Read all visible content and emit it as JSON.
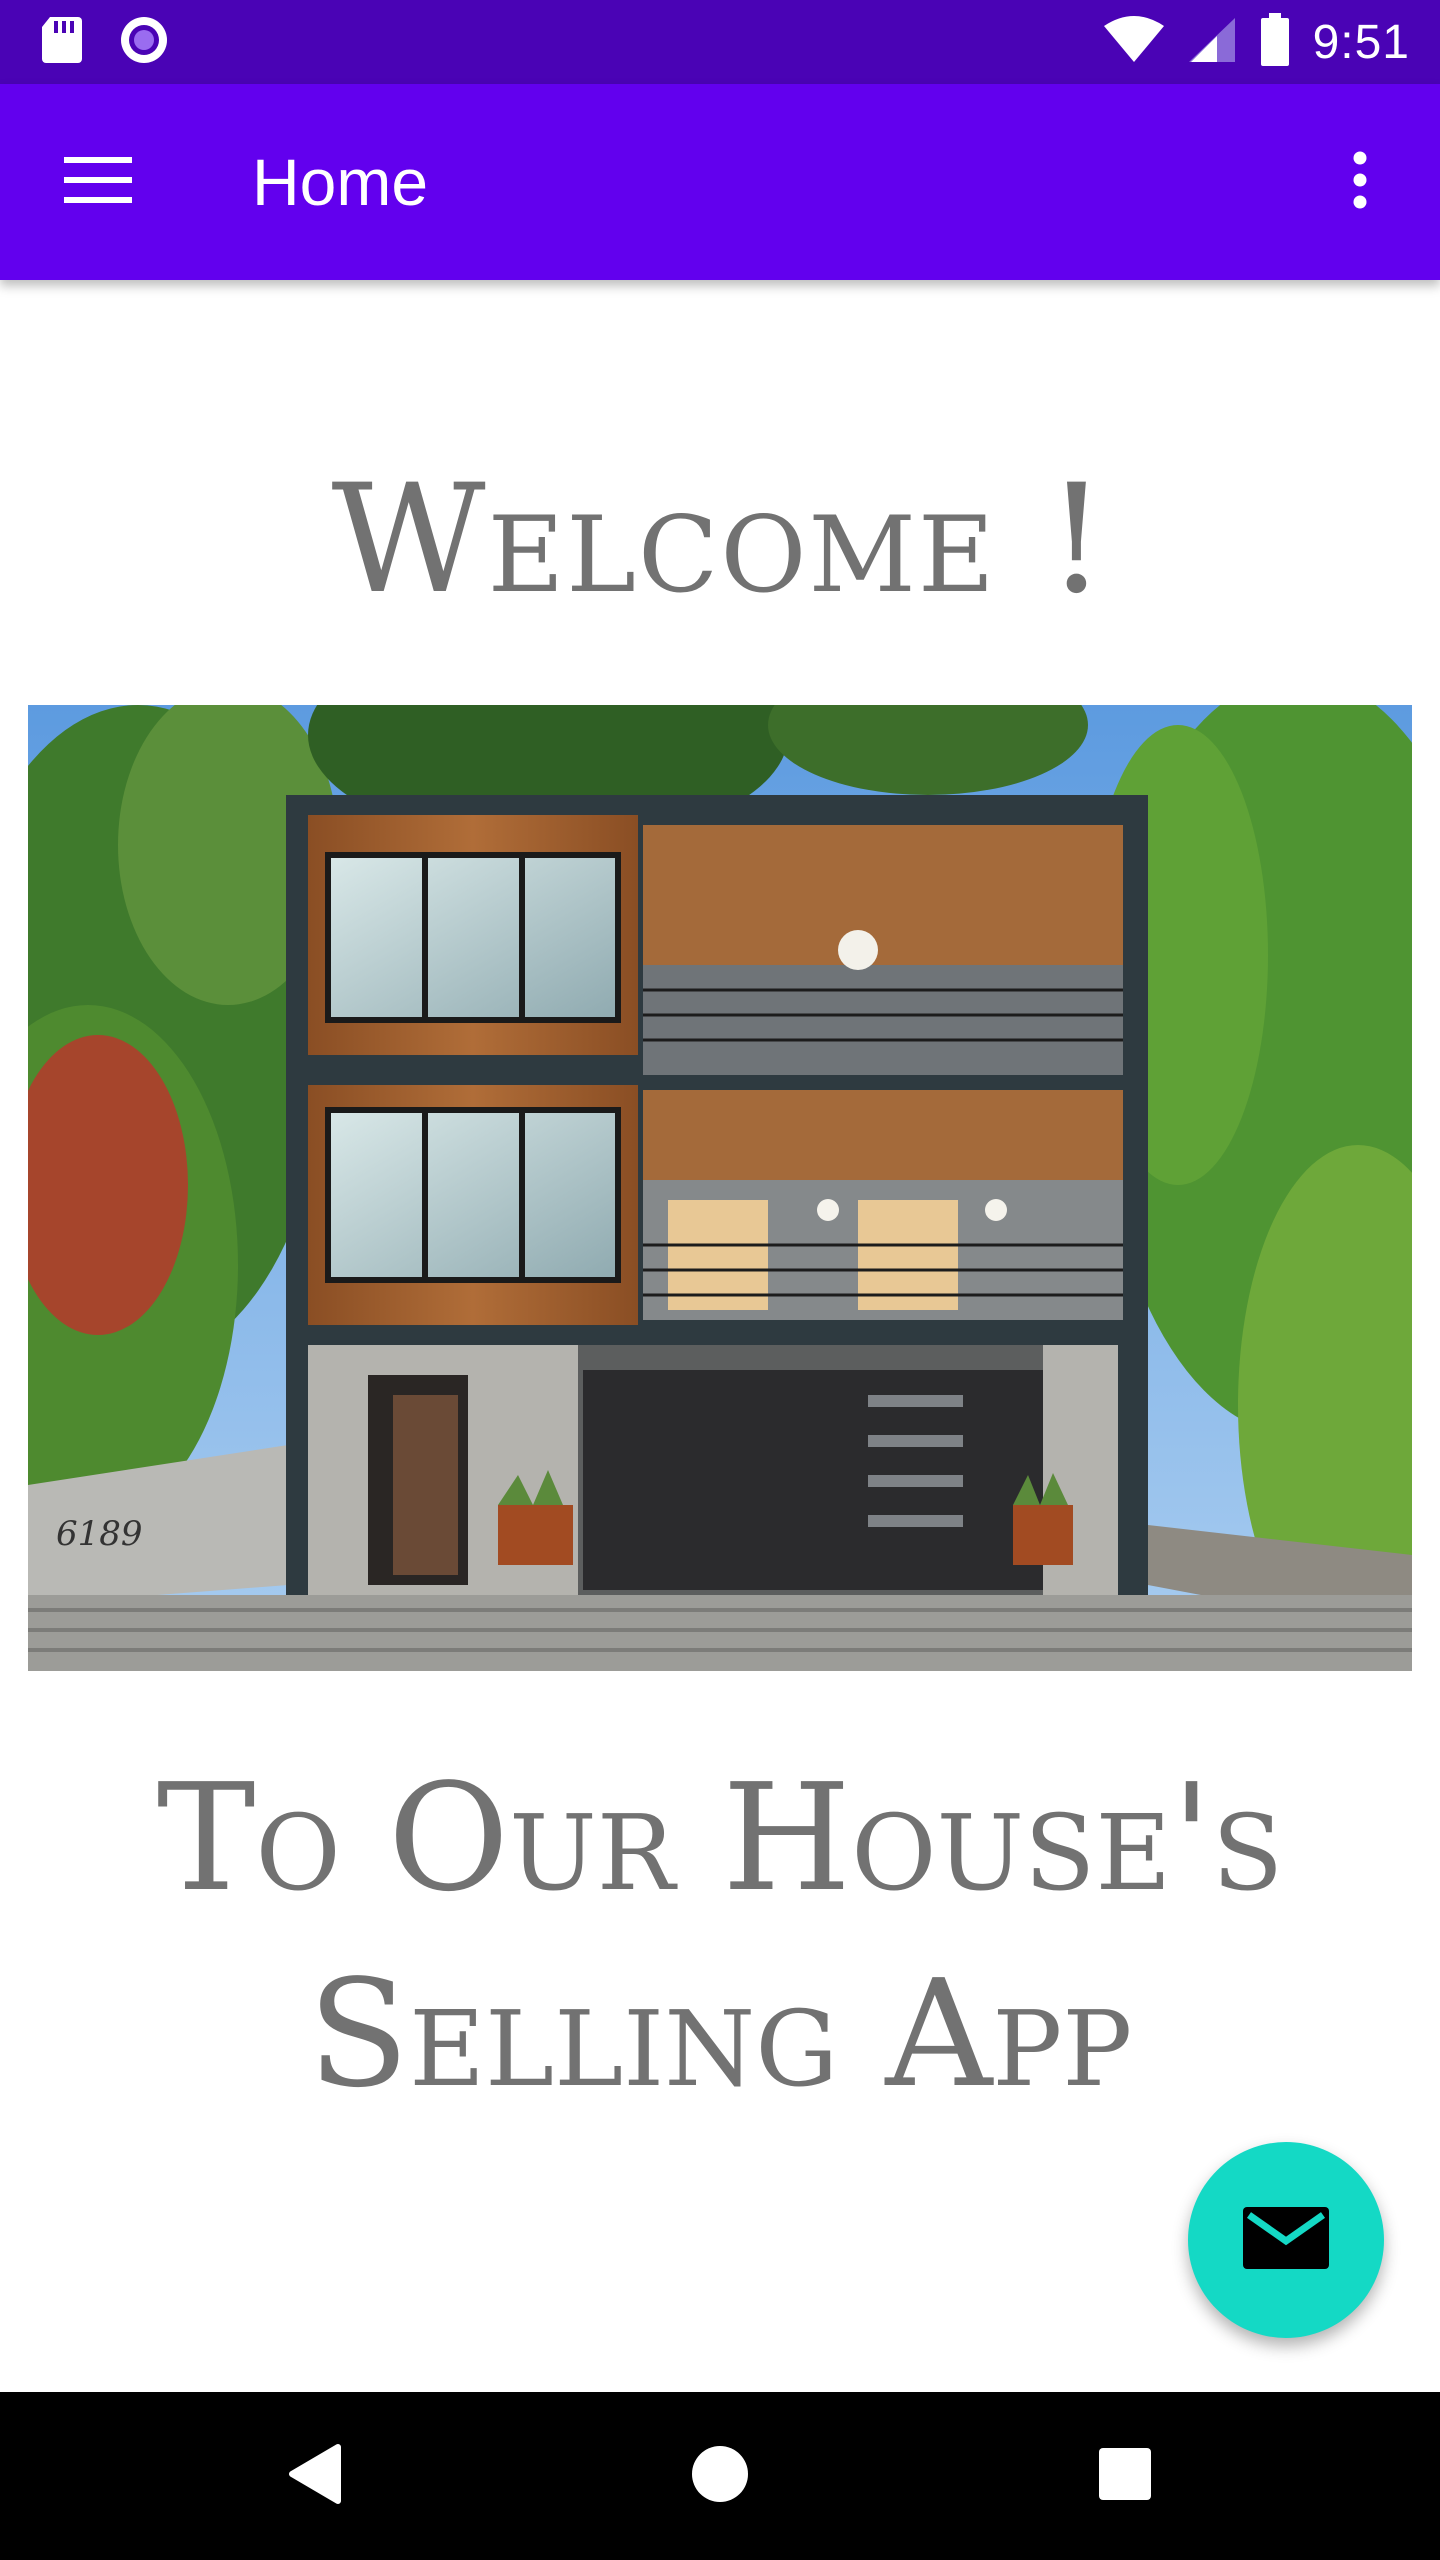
{
  "status_bar": {
    "time": "9:51",
    "left_icons": [
      "sd-card-icon",
      "record-icon"
    ],
    "right_icons": [
      "wifi-icon",
      "signal-icon",
      "battery-icon"
    ]
  },
  "app_bar": {
    "title": "Home",
    "menu_icon": "hamburger-menu-icon",
    "overflow_icon": "more-vertical-icon",
    "color": "#6200ee"
  },
  "content": {
    "welcome": "Welcome !",
    "subtitle_line1": "To Our House's",
    "subtitle_line2": "Selling App",
    "hero_image": "modern-house-photo",
    "house_number": "6189"
  },
  "fab": {
    "icon": "email-icon",
    "color": "#14d9c5"
  },
  "nav_bar": {
    "icons": [
      "back-icon",
      "home-icon",
      "recents-icon"
    ]
  }
}
